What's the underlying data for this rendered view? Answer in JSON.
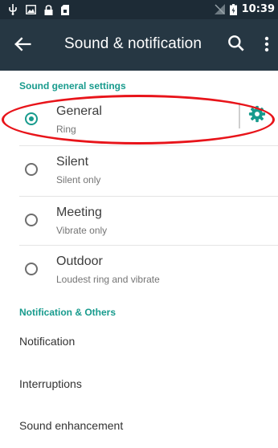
{
  "status_bar": {
    "time": "10:39",
    "left_icons": [
      "usb-icon",
      "image-icon",
      "lock-icon",
      "sd-card-icon"
    ],
    "right_icons": [
      "no-sim-icon",
      "battery-charging-icon"
    ]
  },
  "app_bar": {
    "title": "Sound & notification",
    "background_color": "#263743"
  },
  "sections": {
    "general_header": "Sound general settings",
    "notification_header": "Notification & Others"
  },
  "profiles": [
    {
      "title": "General",
      "subtitle": "Ring",
      "selected": true
    },
    {
      "title": "Silent",
      "subtitle": "Silent only",
      "selected": false
    },
    {
      "title": "Meeting",
      "subtitle": "Vibrate only",
      "selected": false
    },
    {
      "title": "Outdoor",
      "subtitle": "Loudest ring and vibrate",
      "selected": false
    }
  ],
  "other_items": [
    "Notification",
    "Interruptions",
    "Sound enhancement"
  ],
  "accent_color": "#189b8d",
  "highlight_color": "#e8141a"
}
